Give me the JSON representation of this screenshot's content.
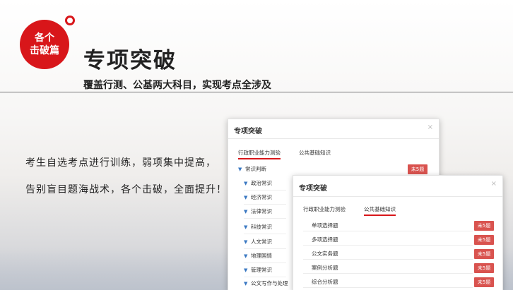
{
  "header": {
    "badge_line1": "各个",
    "badge_line2": "击破篇",
    "title": "专项突破",
    "subtitle": "覆盖行测、公基两大科目，实现考点全涉及"
  },
  "description": [
    "考生自选考点进行训练，弱项集中提高，",
    "告别盲目题海战术，各个击破，全面提升！"
  ],
  "panel1": {
    "title": "专项突破",
    "close": "×",
    "tabs": [
      "行政职业能力测验",
      "公共基础知识"
    ],
    "active_tab": 0,
    "section": "常识判断",
    "section_button": "未5题",
    "items": [
      "政治常识",
      "经济常识",
      "法律常识",
      "科技常识",
      "人文常识",
      "地理国情",
      "管理常识",
      "公文写作与处理"
    ]
  },
  "panel2": {
    "title": "专项突破",
    "close": "×",
    "tabs": [
      "行政职业能力测验",
      "公共基础知识"
    ],
    "active_tab": 1,
    "items": [
      "单项选择题",
      "多项选择题",
      "公文实务题",
      "案例分析题",
      "综合分析题"
    ],
    "button_label": "未5题"
  },
  "colors": {
    "accent": "#d8161a",
    "button": "#d9534f",
    "link": "#3a78c2"
  }
}
